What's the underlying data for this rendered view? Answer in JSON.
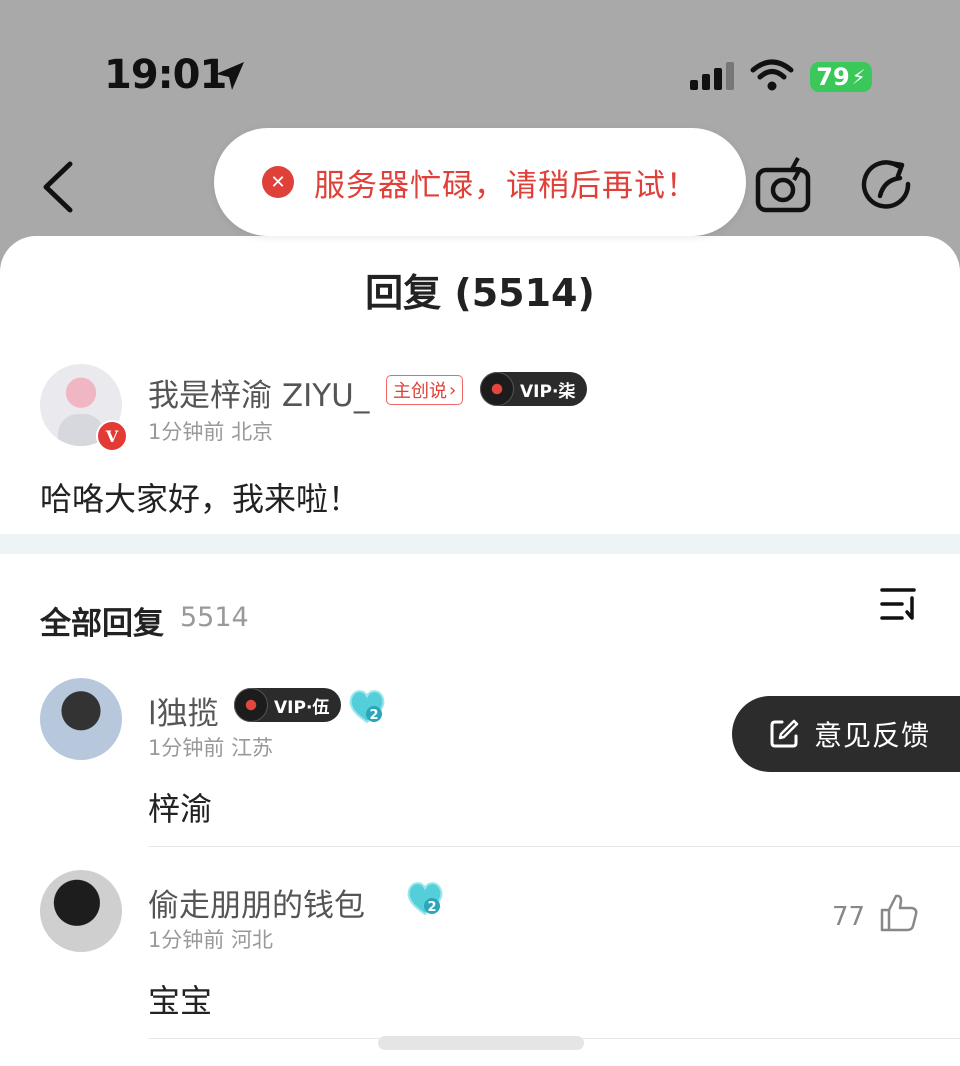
{
  "status_bar": {
    "time": "19:01",
    "battery": "79",
    "battery_color": "#3bc85a"
  },
  "toast": {
    "message": "服务器忙碌，请稍后再试！",
    "color": "#e0403a"
  },
  "nav": {
    "icons": [
      "back-icon",
      "camera-icon",
      "share-icon"
    ]
  },
  "sheet": {
    "title": "回复 (5514)"
  },
  "post": {
    "author": "我是梓渝 ZIYU_",
    "creator_tag": "主创说",
    "vip_label": "VIP·柒",
    "verified_badge": "V",
    "time": "1分钟前",
    "location": "北京",
    "content": "哈咯大家好，我来啦！"
  },
  "replies_header": {
    "label": "全部回复",
    "count": "5514"
  },
  "replies": [
    {
      "author": "l独揽",
      "vip_label": "VIP·伍",
      "level": "2",
      "time": "1分钟前",
      "location": "江苏",
      "content": "梓渝"
    },
    {
      "author": "偷走朋朋的钱包",
      "level": "2",
      "time": "1分钟前",
      "location": "河北",
      "content": "宝宝",
      "likes": "77"
    }
  ],
  "feedback_button": {
    "label": "意见反馈"
  }
}
